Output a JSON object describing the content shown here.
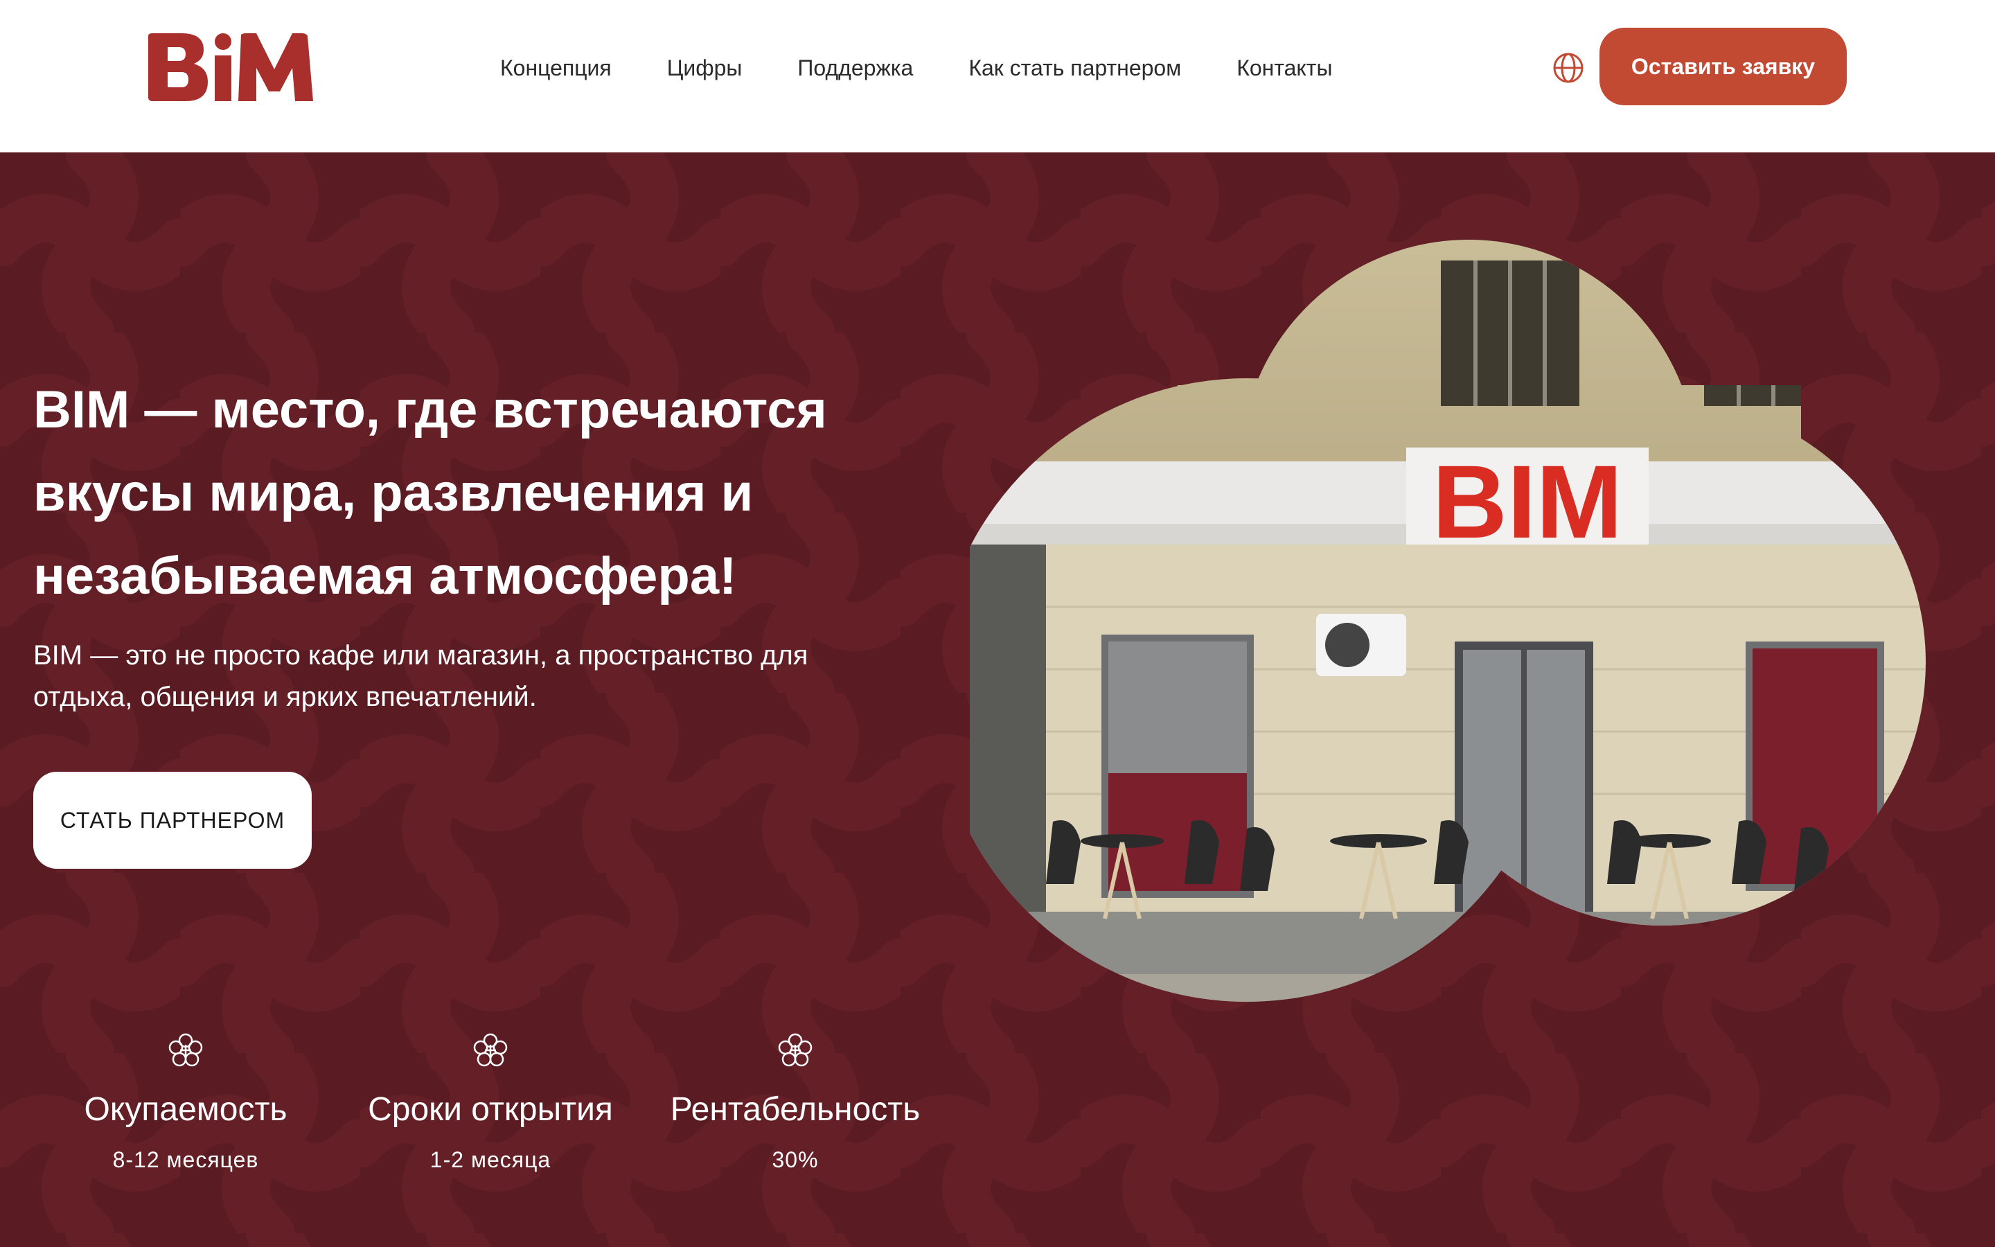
{
  "brand": {
    "logo_text": "BIM",
    "accent_color": "#c24a33",
    "logo_color": "#a82f2c",
    "hero_bg": "#5a1b22"
  },
  "nav": {
    "items": [
      {
        "label": "Концепция"
      },
      {
        "label": "Цифры"
      },
      {
        "label": "Поддержка"
      },
      {
        "label": "Как стать партнером"
      },
      {
        "label": "Контакты"
      }
    ],
    "language_icon": "globe-icon",
    "cta_label": "Оставить заявку"
  },
  "hero": {
    "title_lines": [
      "BIM — место, где встречаются",
      "вкусы мира, развлечения и",
      "незабываемая атмосфера!"
    ],
    "subtitle_lines": [
      "BIM — это не просто кафе или магазин, а пространство для",
      "отдыха, общения и ярких впечатлений."
    ],
    "cta_label": "СТАТЬ ПАРТНЕРОМ",
    "storefront_sign": "BIM"
  },
  "stats": [
    {
      "icon": "flower-icon",
      "label": "Окупаемость",
      "value": "8-12 месяцев"
    },
    {
      "icon": "flower-icon",
      "label": "Сроки открытия",
      "value": "1-2 месяца"
    },
    {
      "icon": "flower-icon",
      "label": "Рентабельность",
      "value": "30%"
    }
  ]
}
